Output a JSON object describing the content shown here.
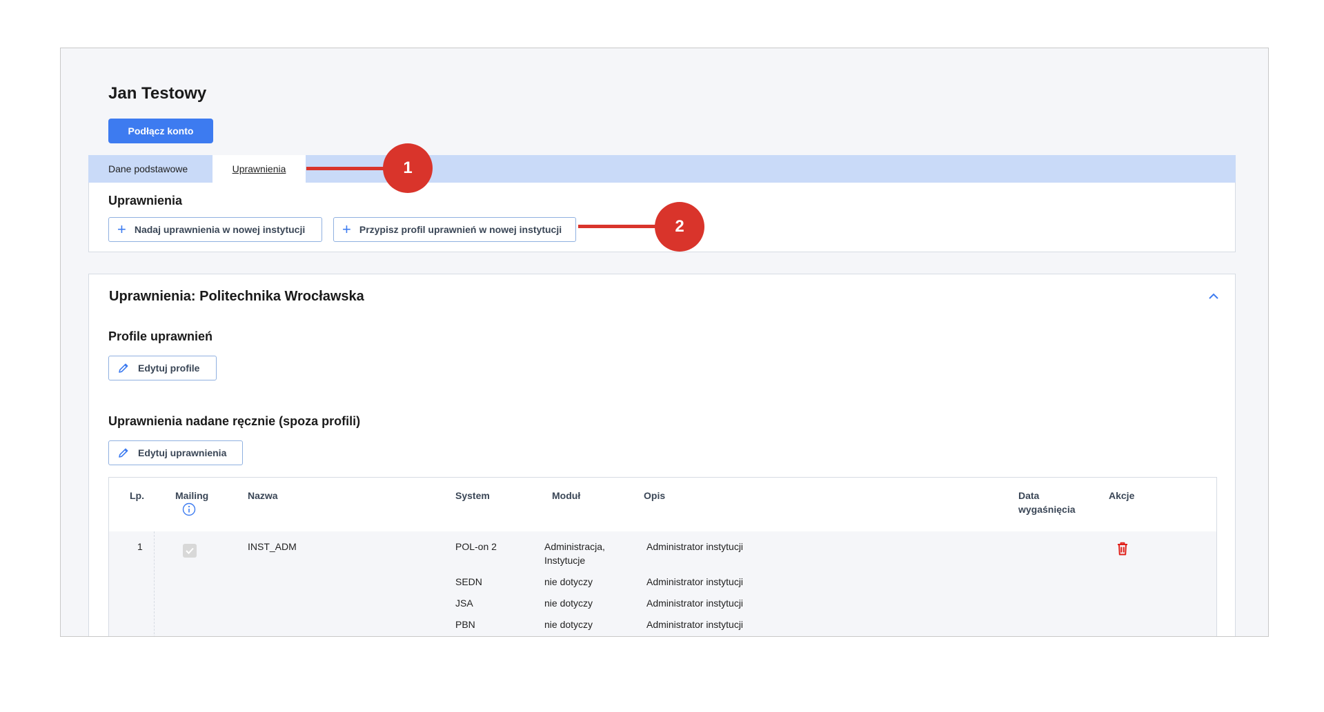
{
  "user": {
    "name": "Jan Testowy",
    "connect_label": "Podłącz konto"
  },
  "tabs": [
    {
      "label": "Dane podstawowe",
      "active": false
    },
    {
      "label": "Uprawnienia",
      "active": true
    }
  ],
  "permissions": {
    "title": "Uprawnienia",
    "grant_new_label": "Nadaj uprawnienia w nowej instytucji",
    "assign_profile_label": "Przypisz profil uprawnień w nowej instytucji"
  },
  "institution": {
    "title": "Uprawnienia: Politechnika Wrocławska",
    "profiles_title": "Profile uprawnień",
    "edit_profiles_label": "Edytuj profile",
    "manual_title": "Uprawnienia nadane ręcznie (spoza profili)",
    "edit_permissions_label": "Edytuj uprawnienia"
  },
  "table": {
    "headers": {
      "lp": "Lp.",
      "mailing": "Mailing",
      "name": "Nazwa",
      "system": "System",
      "module": "Moduł",
      "description": "Opis",
      "expiry_1": "Data",
      "expiry_2": "wygaśnięcia",
      "actions": "Akcje"
    },
    "row": {
      "lp": "1",
      "name": "INST_ADM",
      "entries": [
        {
          "system": "POL-on 2",
          "module_1": "Administracja,",
          "module_2": "Instytucje",
          "description": "Administrator instytucji"
        },
        {
          "system": "SEDN",
          "module_1": "nie dotyczy",
          "module_2": "",
          "description": "Administrator instytucji"
        },
        {
          "system": "JSA",
          "module_1": "nie dotyczy",
          "module_2": "",
          "description": "Administrator instytucji"
        },
        {
          "system": "PBN",
          "module_1": "nie dotyczy",
          "module_2": "",
          "description": "Administrator instytucji"
        }
      ]
    }
  },
  "annotations": [
    {
      "label": "1"
    },
    {
      "label": "2"
    }
  ],
  "colors": {
    "accent": "#3d7bf0",
    "tabbar": "#c9daf8",
    "annotation": "#d9342b",
    "delete": "#e0201a"
  }
}
